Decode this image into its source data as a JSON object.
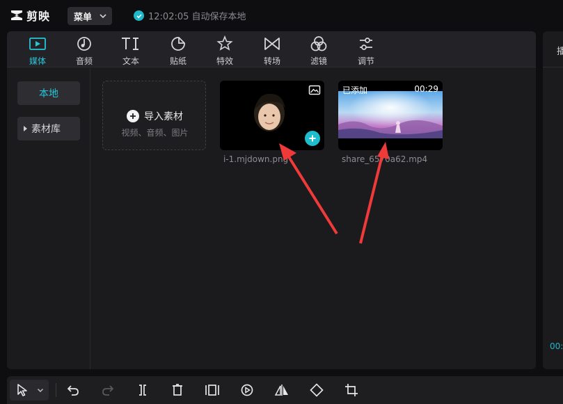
{
  "app": {
    "name": "剪映",
    "menu_label": "菜单",
    "autosave_text": "12:02:05 自动保存本地"
  },
  "tabs": [
    {
      "label": "媒体",
      "icon": "media-icon",
      "active": true
    },
    {
      "label": "音频",
      "icon": "audio-icon"
    },
    {
      "label": "文本",
      "icon": "text-icon"
    },
    {
      "label": "贴纸",
      "icon": "sticker-icon"
    },
    {
      "label": "特效",
      "icon": "effects-icon"
    },
    {
      "label": "转场",
      "icon": "transition-icon"
    },
    {
      "label": "滤镜",
      "icon": "filter-icon"
    },
    {
      "label": "调节",
      "icon": "adjust-icon"
    }
  ],
  "sidebar": {
    "items": [
      {
        "label": "本地",
        "active": true
      },
      {
        "label": "素材库"
      }
    ]
  },
  "import": {
    "title": "导入素材",
    "subtitle": "视频、音频、图片"
  },
  "media": [
    {
      "filename": "i-1.mjdown.png",
      "type": "image"
    },
    {
      "filename": "share_6570a62.mp4",
      "type": "video",
      "added_label": "已添加",
      "duration": "00:29"
    }
  ],
  "preview": {
    "header_label": "播",
    "time": "00:"
  },
  "colors": {
    "accent": "#1fb8c9",
    "arrow": "#f03a3a",
    "panel": "#1b1b1e"
  },
  "toolbar": {
    "icons": [
      "select-arrow-icon",
      "chevron-down-icon",
      "undo-icon",
      "redo-icon",
      "split-icon",
      "delete-icon",
      "freeze-icon",
      "play-speed-icon",
      "mirror-icon",
      "rotate-icon",
      "crop-icon"
    ]
  }
}
